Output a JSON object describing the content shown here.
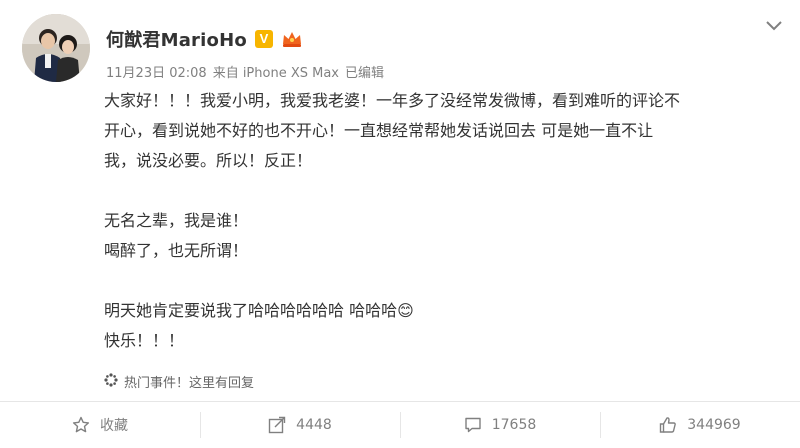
{
  "post": {
    "username": "何猷君MarioHo",
    "verified_badge": "V",
    "timestamp": "11月23日 02:08",
    "source": "来自 iPhone XS Max",
    "edited": "已编辑",
    "paragraphs": [
      "大家好！！！我爱小明，我爱我老婆！一年多了没经常发微博，看到难听的评论不开心，看到说她不好的也不开心！一直想经常帮她发话说回去 可是她一直不让我，说没必要。所以！反正！",
      "",
      "无名之辈，我是谁！",
      "喝醉了，也无所谓！",
      "",
      "明天她肯定要说我了哈哈哈哈哈哈 哈哈哈😊",
      "快乐！！！"
    ],
    "hot_event": "热门事件！这里有回复"
  },
  "actions": {
    "favorite_label": "收藏",
    "repost_count": "4448",
    "comment_count": "17658",
    "like_count": "344969"
  },
  "colors": {
    "text": "#333333",
    "meta": "#808080",
    "badge": "#f7b500",
    "crown": "#f0641e"
  },
  "icons": [
    "avatar",
    "verified-badge-icon",
    "crown-badge-icon",
    "chevron-down-icon",
    "hot-event-icon",
    "star-icon",
    "repost-icon",
    "comment-icon",
    "like-icon"
  ]
}
